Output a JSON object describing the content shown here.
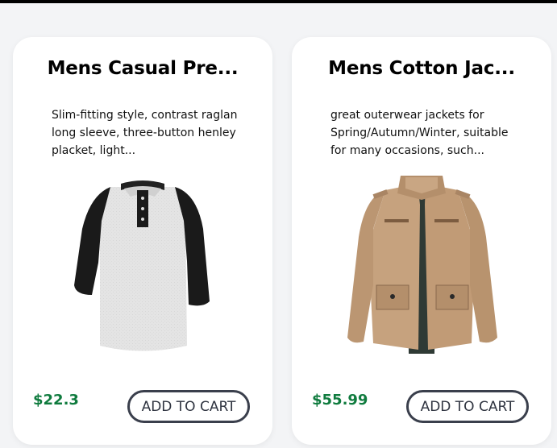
{
  "products": [
    {
      "title": "Mens Casual Pre...",
      "description": "Slim-fitting style, contrast raglan long sleeve, three-button henley placket, light...",
      "price": "$22.3",
      "button_label": "ADD TO CART",
      "image_icon": "henley-shirt-image"
    },
    {
      "title": "Mens Cotton Jac...",
      "description": "great outerwear jackets for Spring/Autumn/Winter, suitable for many occasions, such...",
      "price": "$55.99",
      "button_label": "ADD TO CART",
      "image_icon": "cotton-jacket-image"
    }
  ],
  "colors": {
    "price": "#0f7b3e",
    "button_border": "#3a3f4c",
    "card_bg": "#ffffff",
    "page_bg": "#f3f4f6"
  }
}
